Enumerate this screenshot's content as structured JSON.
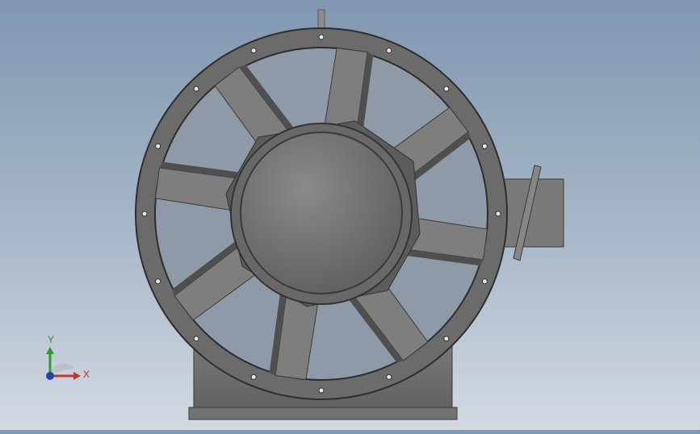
{
  "viewport": {
    "background_top": "#7f97b0",
    "background_bottom": "#d2d9e3"
  },
  "model": {
    "name": "axial-fan",
    "blade_count": 8,
    "bolt_hole_count": 16,
    "colors": {
      "housing": "#6b6b6b",
      "housing_edge": "#3a3a3a",
      "hub": "#707070",
      "blade": "#7e7e7e",
      "base": "#6e6e6e"
    }
  },
  "triad": {
    "x_label": "X",
    "y_label": "Y",
    "x_color": "#c0392b",
    "y_color": "#2e9b2e",
    "z_color": "#2c3fa8"
  }
}
